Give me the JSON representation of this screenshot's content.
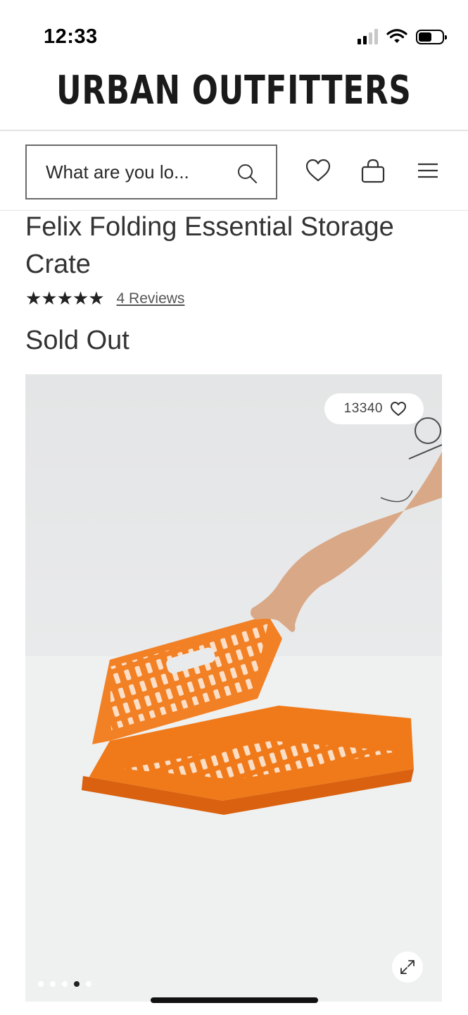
{
  "status_bar": {
    "time": "12:33"
  },
  "brand": {
    "name": "URBAN OUTFITTERS"
  },
  "header": {
    "search_placeholder": "What are you lo...",
    "icons": [
      "search-icon",
      "heart-icon",
      "bag-icon",
      "menu-icon"
    ]
  },
  "product": {
    "title": "Felix Folding Essential Storage Crate",
    "rating_stars": 5,
    "stars_text": "★★★★★",
    "reviews_link": "4 Reviews",
    "availability": "Sold Out",
    "favorites_count": "13340",
    "gallery": {
      "total_images": 5,
      "active_index": 3
    },
    "colors": {
      "crate": "#f07a1a"
    }
  }
}
